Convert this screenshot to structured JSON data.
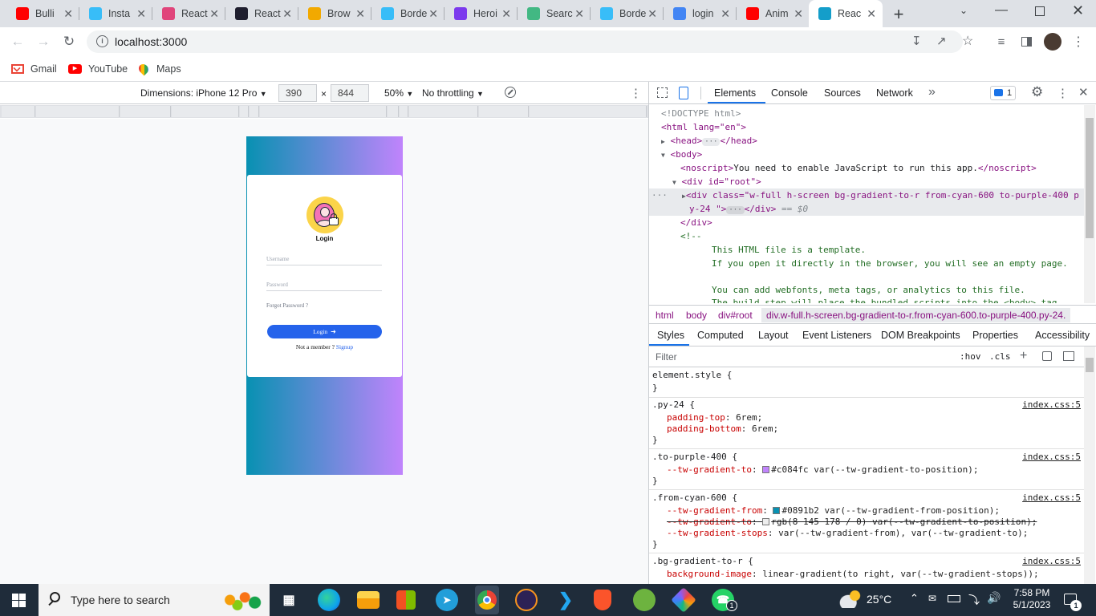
{
  "browser": {
    "tabs": [
      {
        "label": "Bulli",
        "icon": "youtube-icon",
        "color": "#ff0000"
      },
      {
        "label": "Insta",
        "icon": "tailwind-icon",
        "color": "#38bdf8"
      },
      {
        "label": "React",
        "icon": "react-icon",
        "color": "#e0457b"
      },
      {
        "label": "React",
        "icon": "react-native-icon",
        "color": "#1e1e2e"
      },
      {
        "label": "Brow",
        "icon": "browserstack-icon",
        "color": "#f2a900"
      },
      {
        "label": "Borde",
        "icon": "tailwind-icon",
        "color": "#38bdf8"
      },
      {
        "label": "Heroi",
        "icon": "heroicons-icon",
        "color": "#7c3aed"
      },
      {
        "label": "Searc",
        "icon": "vue-icon",
        "color": "#42b883"
      },
      {
        "label": "Borde",
        "icon": "tailwind-icon",
        "color": "#38bdf8"
      },
      {
        "label": "login",
        "icon": "google-icon",
        "color": "#4285f4"
      },
      {
        "label": "Anim",
        "icon": "youtube-icon",
        "color": "#ff0000"
      },
      {
        "label": "Reac",
        "icon": "react-icon",
        "color": "#149eca",
        "active": true
      }
    ],
    "new_tab": "+",
    "url": "localhost:3000",
    "bookmarks": [
      {
        "label": "Gmail",
        "icon": "gmail-icon",
        "color": "#ea4335"
      },
      {
        "label": "YouTube",
        "icon": "youtube-icon",
        "color": "#ff0000"
      },
      {
        "label": "Maps",
        "icon": "maps-icon",
        "color": "#34a853"
      }
    ]
  },
  "emulation": {
    "dimensions_label": "Dimensions: iPhone 12 Pro",
    "width": "390",
    "times": "×",
    "height": "844",
    "zoom": "50%",
    "throttling": "No throttling"
  },
  "app": {
    "title": "Login",
    "username_placeholder": "Username",
    "password_placeholder": "Password",
    "forgot": "Forgot Password ?",
    "login_button": "Login",
    "not_member": "Not a member ?",
    "signup": "Signup",
    "gradient_from": "#0891b2",
    "gradient_to": "#c084fc",
    "button_color": "#2563eb"
  },
  "devtools": {
    "tabs": [
      "Elements",
      "Console",
      "Sources",
      "Network"
    ],
    "active_tab": "Elements",
    "more": "»",
    "issues_count": "1",
    "dom_lines": {
      "doctype": "<!DOCTYPE html>",
      "html_open": "<html lang=\"en\">",
      "head": "<head>",
      "head_close": "</head>",
      "body": "<body>",
      "noscript_open": "<noscript>",
      "noscript_text": "You need to enable JavaScript to run this app.",
      "noscript_close": "</noscript>",
      "div_root": "<div id=\"root\">",
      "div_sel_1": "<div class=\"w-full h-screen bg-gradient-to-r from-cyan-600 to-purple-400 p",
      "div_sel_2a": "y-24 \">",
      "div_sel_2b": "</div>",
      "div_sel_eq": "== $0",
      "div_close": "</div>",
      "comment_open": "<!--",
      "comment_1": "This HTML file is a template.",
      "comment_2": "If you open it directly in the browser, you will see an empty page.",
      "comment_3": "You can add webfonts, meta tags, or analytics to this file.",
      "comment_4": "The build step will place the bundled scripts into the <body> tag."
    },
    "breadcrumb": [
      "html",
      "body",
      "div#root",
      "div.w-full.h-screen.bg-gradient-to-r.from-cyan-600.to-purple-400.py-24."
    ],
    "subtabs": [
      "Styles",
      "Computed",
      "Layout",
      "Event Listeners",
      "DOM Breakpoints",
      "Properties",
      "Accessibility"
    ],
    "active_subtab": "Styles",
    "filter_placeholder": "Filter",
    "hov": ":hov",
    "cls": ".cls",
    "rules": {
      "element_style": "element.style {",
      "close": "}",
      "py24_sel": ".py-24 {",
      "py24_p1_name": "padding-top",
      "py24_p1_val": "6rem;",
      "py24_p2_name": "padding-bottom",
      "py24_p2_val": "6rem;",
      "src": "index.css:5",
      "purple_sel": ".to-purple-400 {",
      "purple_name": "--tw-gradient-to",
      "purple_val": "#c084fc var(--tw-gradient-to-position);",
      "cyan_sel": ".from-cyan-600 {",
      "cyan_p1_name": "--tw-gradient-from",
      "cyan_p1_val": "#0891b2 var(--tw-gradient-from-position);",
      "cyan_p2_name": "--tw-gradient-to",
      "cyan_p2_val": "rgb(8 145 178 / 0) var(--tw-gradient-to-position);",
      "cyan_p3_name": "--tw-gradient-stops",
      "cyan_p3_val": "var(--tw-gradient-from), var(--tw-gradient-to);",
      "bg_sel": ".bg-gradient-to-r {",
      "bg_name": "background-image",
      "bg_val": "linear-gradient(to right, var(--tw-gradient-stops));",
      "colon": ":"
    }
  },
  "taskbar": {
    "search_placeholder": "Type here to search",
    "temperature": "25°C",
    "time": "7:58 PM",
    "date": "5/1/2023",
    "notification_count": "1",
    "whatsapp_badge": "1"
  }
}
